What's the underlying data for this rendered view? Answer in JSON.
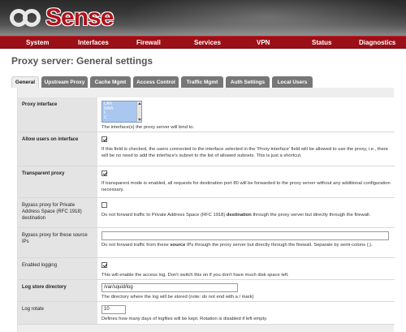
{
  "app": {
    "logo_text": "Sense",
    "brand_color": "#9b0f17"
  },
  "nav": {
    "items": [
      "System",
      "Interfaces",
      "Firewall",
      "Services",
      "VPN",
      "Status",
      "Diagnostics"
    ]
  },
  "page": {
    "title": "Proxy server: General settings"
  },
  "tabs": [
    {
      "label": "General",
      "active": true
    },
    {
      "label": "Upstream Proxy",
      "active": false
    },
    {
      "label": "Cache Mgmt",
      "active": false
    },
    {
      "label": "Access Control",
      "active": false
    },
    {
      "label": "Traffic Mgmt",
      "active": false
    },
    {
      "label": "Auth Settings",
      "active": false
    },
    {
      "label": "Local Users",
      "active": false
    }
  ],
  "form": {
    "proxy_interface": {
      "label": "Proxy interface",
      "options": [
        "LAN",
        "WAN",
        "L",
        "C"
      ],
      "description": "The interface(s) the proxy server will bind to."
    },
    "allow_users": {
      "label": "Allow users on interface",
      "checked": true,
      "description": "If this field is checked, the users connected to the interface selected in the 'Proxy interface' field will be allowed to use the proxy, i.e., there will be no need to add the interface's subnet to the list of allowed subnets. This is just a shortcut."
    },
    "transparent": {
      "label": "Transparent proxy",
      "checked": true,
      "description": "If transparent mode is enabled, all requests for destination port 80 will be forwarded to the proxy server without any additional configuration necessary."
    },
    "bypass_private": {
      "label": "Bypass proxy for Private Address Space (RFC 1918) destination",
      "checked": false,
      "desc_pre": "Do not forward traffic to Private Address Space (RFC 1918) ",
      "desc_bold": "destination",
      "desc_post": " through the proxy server but directly through the firewall."
    },
    "bypass_source": {
      "label": "Bypass proxy for these source IPs",
      "value": "",
      "desc_pre": "Do not forward traffic from these ",
      "desc_bold": "source",
      "desc_post": " IPs through the proxy server but directly through the firewall. Separate by semi-colons (;)."
    },
    "logging": {
      "label": "Enabled logging",
      "checked": true,
      "description": "This will enable the access log. Don't switch this on if you don't have much disk space left."
    },
    "log_dir": {
      "label": "Log store directory",
      "value": "/var/squid/log",
      "description": "The directory where the log will be stored (note: do not end with a / mark)"
    },
    "log_rotate": {
      "label": "Log rotate",
      "value": "10",
      "description": "Defines how many days of logfiles will be kept. Rotation is disabled if left empty."
    }
  }
}
